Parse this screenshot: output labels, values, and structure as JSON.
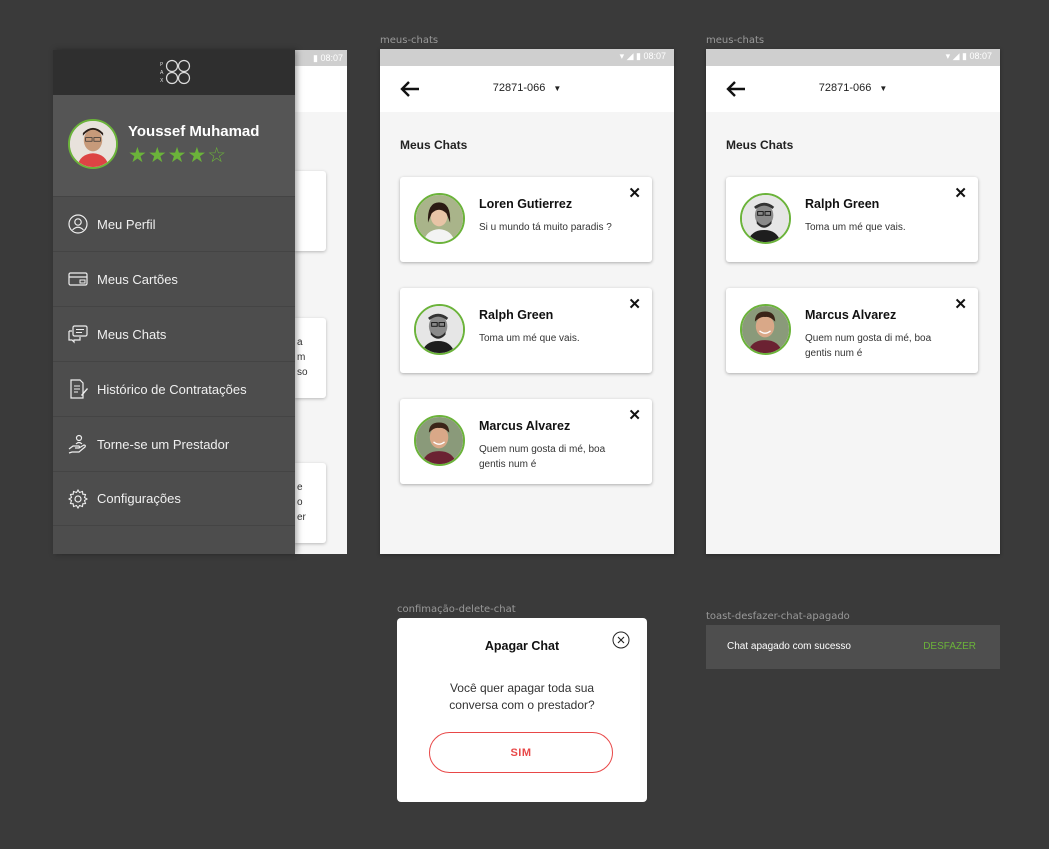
{
  "colors": {
    "accent": "#6bb33a",
    "danger": "#e84848",
    "background": "#3a3a3a",
    "drawer": "#4d4d4d"
  },
  "drawer_screen": {
    "status_time": "08:07",
    "logo_letters": "PAX",
    "profile": {
      "name": "Youssef Muhamad",
      "stars": "★★★★☆",
      "rating": 4,
      "rating_max": 5
    },
    "menu": [
      {
        "label": "Meu Perfil",
        "icon": "user-circle-icon"
      },
      {
        "label": "Meus Cartões",
        "icon": "credit-card-icon"
      },
      {
        "label": "Meus Chats",
        "icon": "chat-bubbles-icon"
      },
      {
        "label": "Histórico de Contratações",
        "icon": "document-edit-icon"
      },
      {
        "label": "Torne-se um Prestador",
        "icon": "hand-user-icon"
      },
      {
        "label": "Configurações",
        "icon": "gear-icon"
      }
    ],
    "background_fragments": [
      {
        "lines": [
          "a",
          "m",
          "so"
        ]
      },
      {
        "lines": [
          "e",
          "o",
          "er"
        ]
      }
    ]
  },
  "screen1": {
    "label": "meus-chats",
    "status_time": "08:07",
    "cep": "72871-066",
    "title": "Meus Chats",
    "chats": [
      {
        "name": "Loren Gutierrez",
        "message": "Si u mundo tá muito paradis ?"
      },
      {
        "name": "Ralph Green",
        "message": "Toma um mé que vais."
      },
      {
        "name": "Marcus Alvarez",
        "message": "Quem num gosta di mé, boa gentis num é"
      }
    ]
  },
  "screen2": {
    "label": "meus-chats",
    "status_time": "08:07",
    "cep": "72871-066",
    "title": "Meus Chats",
    "chats": [
      {
        "name": "Ralph Green",
        "message": "Toma um mé que vais."
      },
      {
        "name": "Marcus Alvarez",
        "message": "Quem num gosta di mé, boa gentis num é"
      }
    ]
  },
  "dialog": {
    "label": "confimação-delete-chat",
    "title": "Apagar Chat",
    "text": "Você quer apagar toda sua conversa com o prestador?",
    "confirm": "SIM"
  },
  "toast": {
    "label": "toast-desfazer-chat-apagado",
    "message": "Chat apagado com sucesso",
    "action": "DESFAZER"
  }
}
